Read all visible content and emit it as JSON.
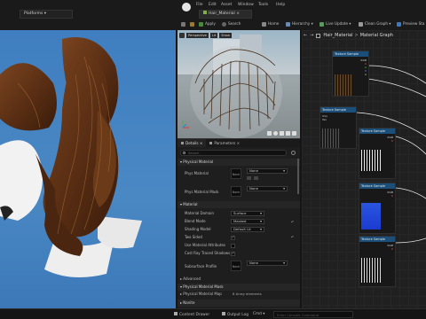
{
  "menu": [
    "File",
    "Edit",
    "Asset",
    "Window",
    "Tools",
    "Help"
  ],
  "left_tab": {
    "label": "Platforms"
  },
  "asset_tab": {
    "label": "Hair_Material"
  },
  "toolbar": {
    "home": "Home",
    "hierarchy": "Hierarchy",
    "live_update": "Live Update",
    "clean_graph": "Clean Graph",
    "preview_stats": "Preview Sta"
  },
  "preview": {
    "perspective": "Perspective",
    "lit": "Lit",
    "show": "Show"
  },
  "details": {
    "tab_details": "Details",
    "tab_parameters": "Parameters",
    "search_placeholder": "Search",
    "physical_material_header": "Physical Material",
    "phys_material_label": "Phys Material",
    "phys_material_value": "None",
    "phys_material_mask_label": "Phys Material Mask",
    "phys_material_mask_value": "None",
    "material_header": "Material",
    "rows": [
      {
        "label": "Material Domain",
        "value": "Surface"
      },
      {
        "label": "Blend Mode",
        "value": "Masked"
      },
      {
        "label": "Shading Model",
        "value": "Default Lit"
      },
      {
        "label": "Two Sided",
        "value": ""
      },
      {
        "label": "Use Material Attributes",
        "value": ""
      },
      {
        "label": "Cast Ray Traced Shadows",
        "value": ""
      }
    ],
    "subsurface_label": "Subsurface Profile",
    "subsurface_value": "None",
    "advanced": "Advanced",
    "phys_mat_mask_header": "Physical Material Mask",
    "phys_mat_map_label": "Physical Material Map",
    "phys_mat_map_value": "8 Array elements",
    "nanite_header": "Nanite"
  },
  "graph": {
    "breadcrumb": "Hair_Material",
    "breadcrumb_sep": ">",
    "title": "Material Graph",
    "nodes": [
      {
        "title": "Texture Sample",
        "pins": [
          "RGB",
          "R",
          "G",
          "B",
          "A",
          "RGBA"
        ]
      },
      {
        "title": "Texture Sample",
        "pins": [
          "UVs",
          "Tex",
          "Apply View MipBias"
        ]
      },
      {
        "title": "Texture Sample",
        "pins": [
          "RGB",
          "R",
          "G",
          "B",
          "A"
        ]
      },
      {
        "title": "Texture Sample",
        "pins": [
          "RGB",
          "R",
          "G",
          "B",
          "A"
        ]
      },
      {
        "title": "Texture Sample",
        "pins": [
          "RGB",
          "R",
          "G",
          "B",
          "A"
        ]
      }
    ]
  },
  "bottombar": {
    "content_drawer": "Content Drawer",
    "output_log": "Output Log",
    "cmd": "Cmd",
    "console_placeholder": "Enter Console Command"
  },
  "colors": {
    "accent": "#1b4f7a",
    "viewport_sky": "#4a88c4"
  }
}
